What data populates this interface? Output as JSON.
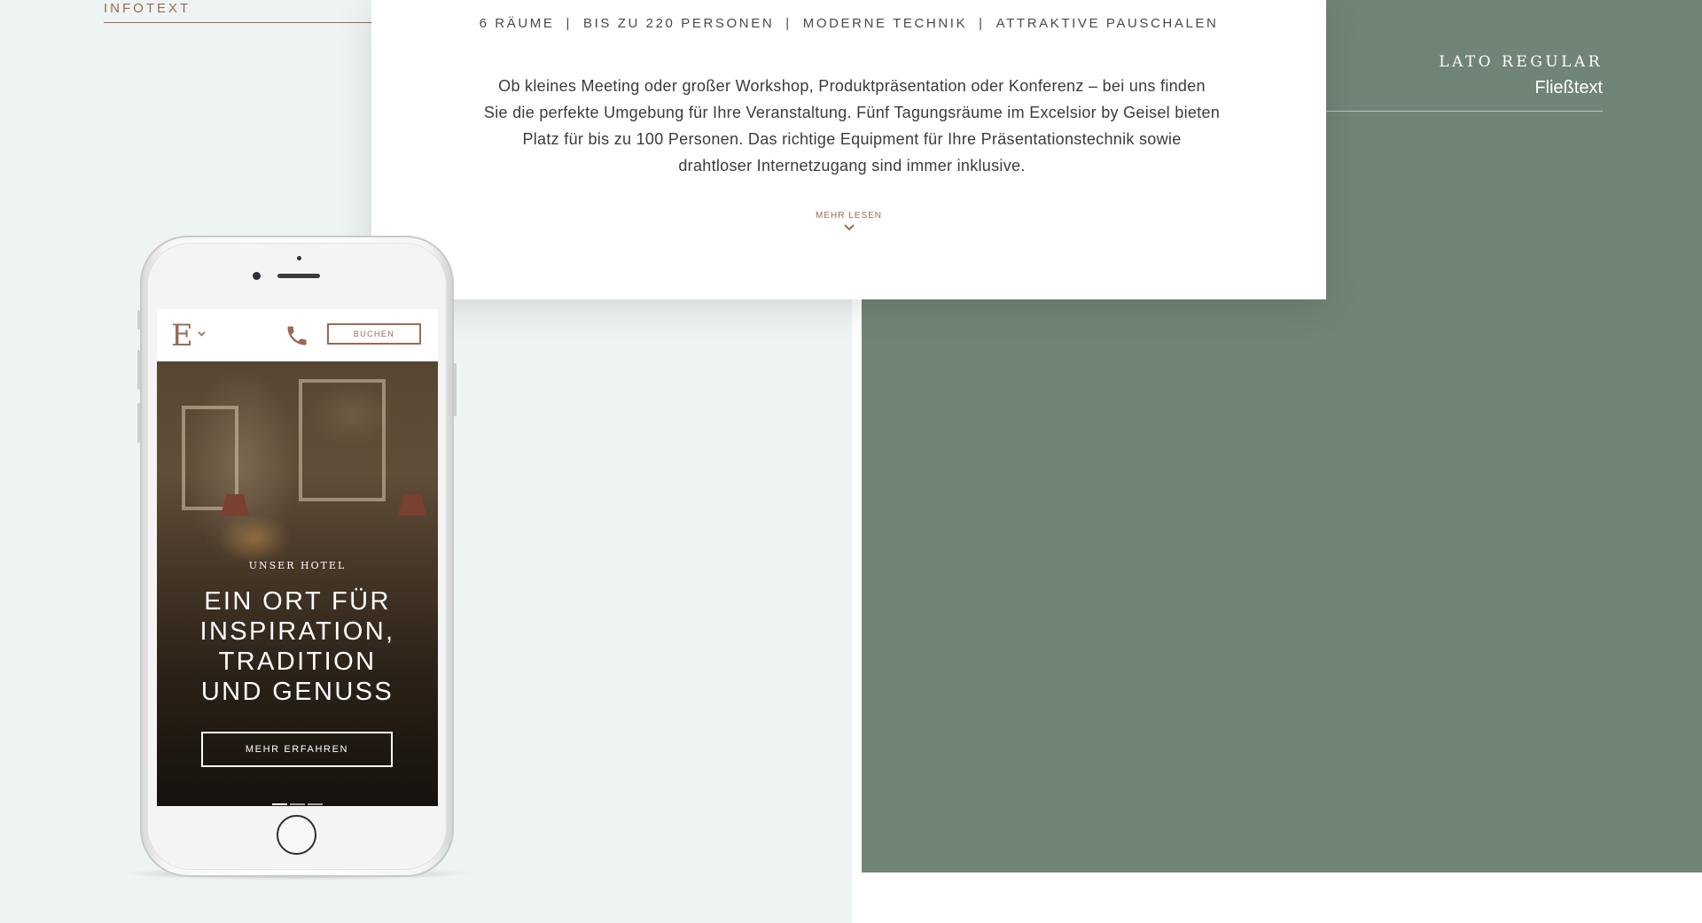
{
  "infotext": "INFOTEXT",
  "font_sample": {
    "name": "LATO REGULAR",
    "style": "Fließtext"
  },
  "card": {
    "features": [
      "6 RÄUME",
      "BIS ZU 220 PERSONEN",
      "MODERNE TECHNIK",
      "ATTRAKTIVE PAUSCHALEN"
    ],
    "separator": "|",
    "text_lines": [
      "Ob kleines Meeting oder großer Workshop, Produktpräsentation oder Konferenz – bei uns finden",
      "Sie die perfekte Umgebung für Ihre Veranstaltung. Fünf Tagungsräume im Excelsior by Geisel bieten",
      "Platz für bis zu 100 Personen. Das richtige Equipment für Ihre Präsentationstechnik sowie",
      "drahtloser Internetzugang sind immer inklusive."
    ],
    "more_label": "MEHR LESEN"
  },
  "mobile": {
    "logo": "E",
    "book_label": "BUCHEN",
    "hero_subtitle": "UNSER HOTEL",
    "hero_title_lines": [
      "EIN ORT FÜR",
      "INSPIRATION,",
      "TRADITION",
      "UND GENUSS"
    ],
    "cta_label": "MEHR ERFAHREN",
    "slides": 3,
    "active_slide": 1
  },
  "colors": {
    "accent_brown": "#9a6a55",
    "panel_green": "#708576",
    "panel_light": "#eef3f3"
  },
  "icons": [
    "chevron-down-icon",
    "phone-icon"
  ]
}
